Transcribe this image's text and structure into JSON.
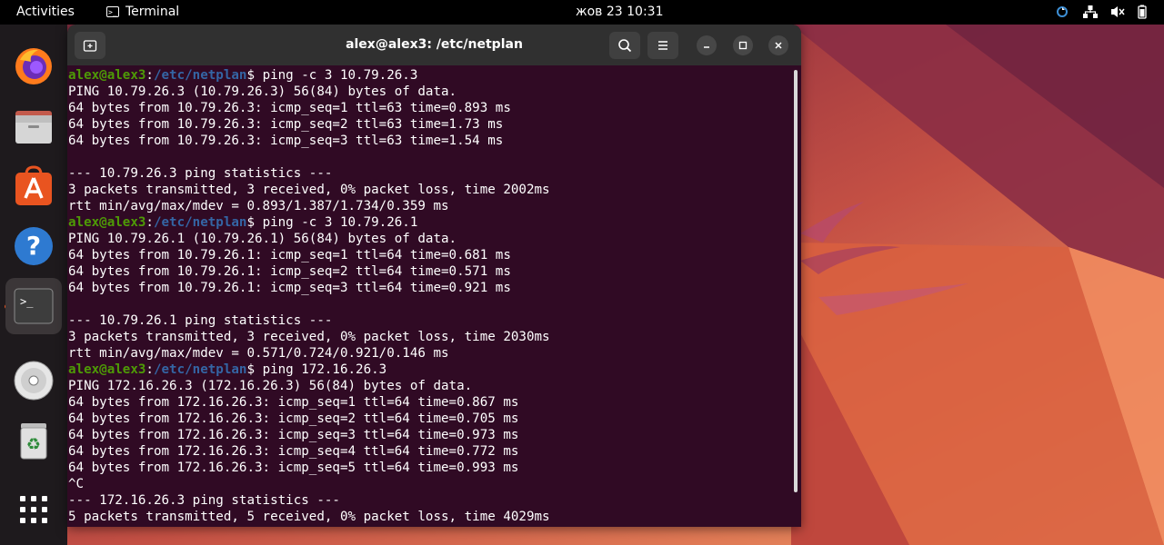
{
  "topbar": {
    "activities": "Activities",
    "app_name": "Terminal",
    "app_icon_glyph": ">_",
    "clock": "жов 23  10:31"
  },
  "dock": {
    "items": [
      "firefox-icon",
      "files-icon",
      "app-center-icon",
      "help-icon",
      "terminal-icon",
      "disc-icon",
      "trash-icon",
      "show-apps-icon"
    ]
  },
  "terminal": {
    "title": "alex@alex3: /etc/netplan",
    "prompt_user": "alex@alex3",
    "prompt_path": "/etc/netplan",
    "lines": [
      {
        "type": "prompt",
        "cmd": "ping -c 3 10.79.26.3"
      },
      {
        "type": "out",
        "text": "PING 10.79.26.3 (10.79.26.3) 56(84) bytes of data."
      },
      {
        "type": "out",
        "text": "64 bytes from 10.79.26.3: icmp_seq=1 ttl=63 time=0.893 ms"
      },
      {
        "type": "out",
        "text": "64 bytes from 10.79.26.3: icmp_seq=2 ttl=63 time=1.73 ms"
      },
      {
        "type": "out",
        "text": "64 bytes from 10.79.26.3: icmp_seq=3 ttl=63 time=1.54 ms"
      },
      {
        "type": "out",
        "text": ""
      },
      {
        "type": "out",
        "text": "--- 10.79.26.3 ping statistics ---"
      },
      {
        "type": "out",
        "text": "3 packets transmitted, 3 received, 0% packet loss, time 2002ms"
      },
      {
        "type": "out",
        "text": "rtt min/avg/max/mdev = 0.893/1.387/1.734/0.359 ms"
      },
      {
        "type": "prompt",
        "cmd": "ping -c 3 10.79.26.1"
      },
      {
        "type": "out",
        "text": "PING 10.79.26.1 (10.79.26.1) 56(84) bytes of data."
      },
      {
        "type": "out",
        "text": "64 bytes from 10.79.26.1: icmp_seq=1 ttl=64 time=0.681 ms"
      },
      {
        "type": "out",
        "text": "64 bytes from 10.79.26.1: icmp_seq=2 ttl=64 time=0.571 ms"
      },
      {
        "type": "out",
        "text": "64 bytes from 10.79.26.1: icmp_seq=3 ttl=64 time=0.921 ms"
      },
      {
        "type": "out",
        "text": ""
      },
      {
        "type": "out",
        "text": "--- 10.79.26.1 ping statistics ---"
      },
      {
        "type": "out",
        "text": "3 packets transmitted, 3 received, 0% packet loss, time 2030ms"
      },
      {
        "type": "out",
        "text": "rtt min/avg/max/mdev = 0.571/0.724/0.921/0.146 ms"
      },
      {
        "type": "prompt",
        "cmd": "ping 172.16.26.3"
      },
      {
        "type": "out",
        "text": "PING 172.16.26.3 (172.16.26.3) 56(84) bytes of data."
      },
      {
        "type": "out",
        "text": "64 bytes from 172.16.26.3: icmp_seq=1 ttl=64 time=0.867 ms"
      },
      {
        "type": "out",
        "text": "64 bytes from 172.16.26.3: icmp_seq=2 ttl=64 time=0.705 ms"
      },
      {
        "type": "out",
        "text": "64 bytes from 172.16.26.3: icmp_seq=3 ttl=64 time=0.973 ms"
      },
      {
        "type": "out",
        "text": "64 bytes from 172.16.26.3: icmp_seq=4 ttl=64 time=0.772 ms"
      },
      {
        "type": "out",
        "text": "64 bytes from 172.16.26.3: icmp_seq=5 ttl=64 time=0.993 ms"
      },
      {
        "type": "out",
        "text": "^C"
      },
      {
        "type": "out",
        "text": "--- 172.16.26.3 ping statistics ---"
      },
      {
        "type": "out",
        "text": "5 packets transmitted, 5 received, 0% packet loss, time 4029ms"
      }
    ]
  },
  "colors": {
    "terminal_bg": "#300a24",
    "prompt_user": "#4e9a06",
    "prompt_path": "#3465a4",
    "accent": "#e95420"
  }
}
